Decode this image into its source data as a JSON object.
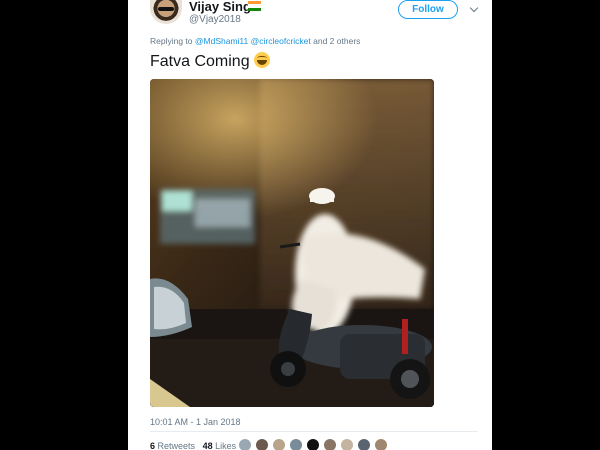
{
  "author": {
    "name": "Vijay Singh",
    "handle": "@Vjay2018",
    "flag_icon": "india-flag-icon",
    "avatar_icon": "avatar"
  },
  "follow": {
    "label": "Follow"
  },
  "menu": {
    "icon": "chevron-down-icon"
  },
  "reply": {
    "prefix": "Replying to",
    "mention1": "@MdShami11",
    "mention2": "@circleofcricket",
    "suffix": "and 2 others"
  },
  "tweet": {
    "text": "Fatva Coming",
    "emoji_icon": "grinning-face-emoji-icon"
  },
  "timestamp": "10:01 AM - 1 Jan 2018",
  "stats": {
    "retweets_count": "6",
    "retweets_label": "Retweets",
    "likes_count": "48",
    "likes_label": "Likes"
  },
  "colors": {
    "accent": "#1da1f2",
    "text": "#14171a",
    "muted": "#657786",
    "background": "#000000"
  }
}
